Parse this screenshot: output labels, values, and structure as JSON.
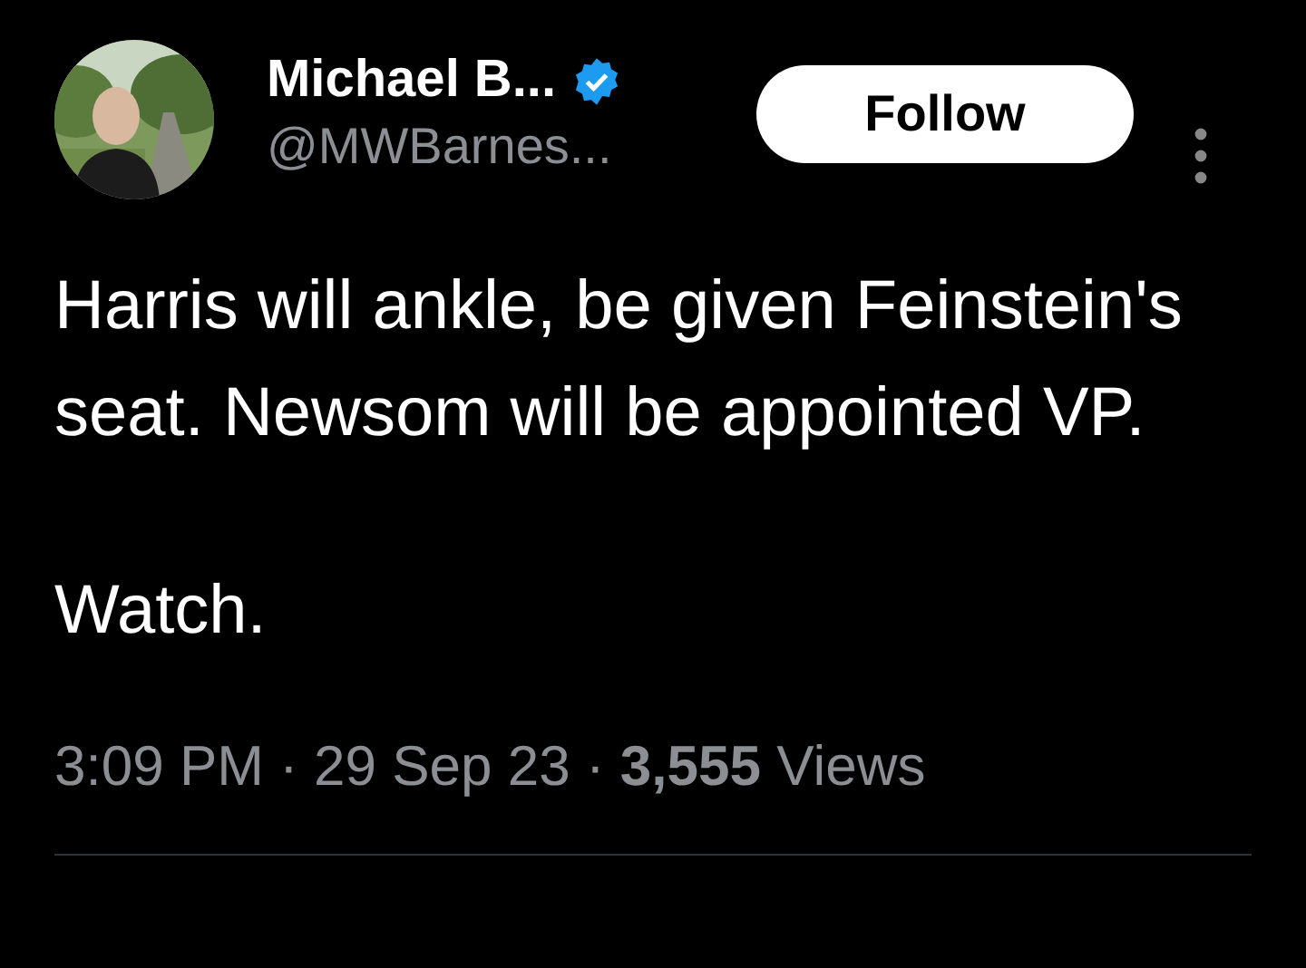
{
  "author": {
    "name": "Michael B...",
    "verified": true,
    "handle": "@MWBarnes..."
  },
  "follow_button": {
    "label": "Follow"
  },
  "paragraphs": [
    "Harris will ankle, be given Feinstein's  seat. Newsom will be appointed VP.",
    "Watch."
  ],
  "meta": "3:09 PM · 29 Sep 23 · **3,555** Views"
}
